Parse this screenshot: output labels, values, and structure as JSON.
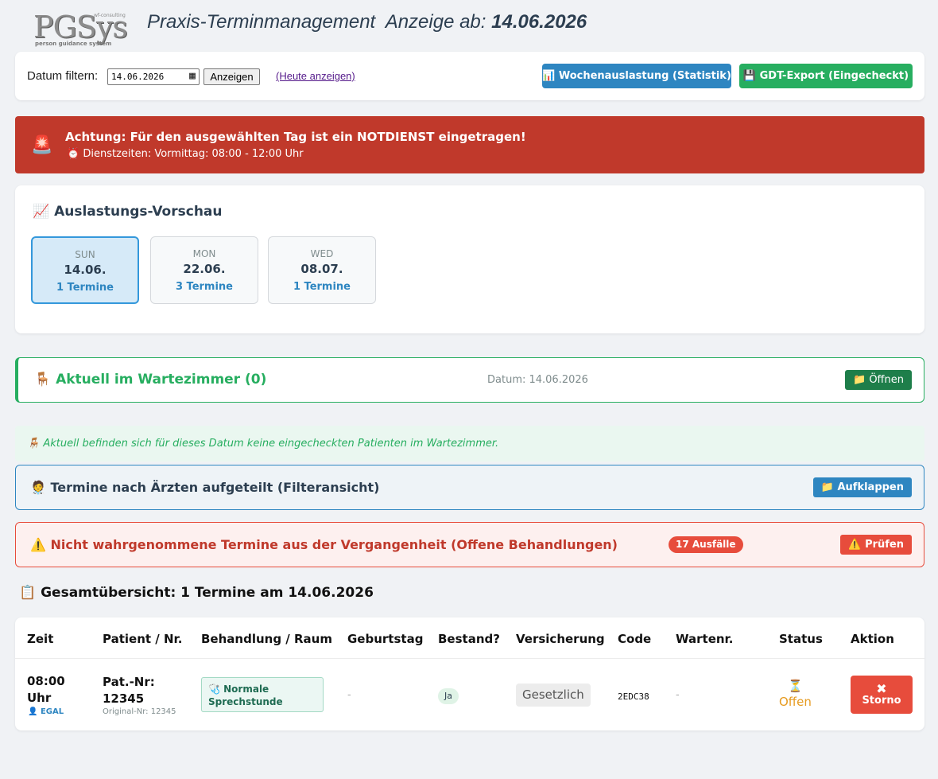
{
  "logo": {
    "text": "PGSys",
    "subtitle": "person guidance system",
    "topline": "wf-consulting"
  },
  "header": {
    "title": "Praxis-Terminmanagement",
    "date_prefix": "Anzeige ab:",
    "date": "14.06.2026"
  },
  "filter": {
    "label": "Datum filtern:",
    "date_value": "14.06.2026",
    "show_button": "Anzeigen",
    "today_link": "(Heute anzeigen)",
    "week_button": "Wochenauslastung (Statistik)",
    "gdt_button": "GDT-Export (Eingecheckt)"
  },
  "alert": {
    "title": "Achtung: Für den ausgewählten Tag ist ein NOTDIENST eingetragen!",
    "subtitle": "Dienstzeiten: Vormittag: 08:00 - 12:00 Uhr"
  },
  "preview": {
    "title": "Auslastungs-Vorschau",
    "days": [
      {
        "dow": "SUN",
        "date": "14.06.",
        "count": "1 Termine",
        "active": true
      },
      {
        "dow": "MON",
        "date": "22.06.",
        "count": "3 Termine",
        "active": false
      },
      {
        "dow": "WED",
        "date": "08.07.",
        "count": "1 Termine",
        "active": false
      }
    ]
  },
  "waiting": {
    "title": "Aktuell im Wartezimmer (0)",
    "date": "Datum: 14.06.2026",
    "open_button": "Öffnen",
    "empty_message": "Aktuell befinden sich für dieses Datum keine eingecheckten Patienten im Wartezimmer."
  },
  "doctors": {
    "title": "Termine nach Ärzten aufgeteilt (Filteransicht)",
    "button": "Aufklappen"
  },
  "missed": {
    "title": "Nicht wahrgenommene Termine aus der Vergangenheit (Offene Behandlungen)",
    "badge": "17 Ausfälle",
    "button": "Prüfen"
  },
  "overview": {
    "title": "Gesamtübersicht: 1 Termine am 14.06.2026",
    "columns": [
      "Zeit",
      "Patient / Nr.",
      "Behandlung / Raum",
      "Geburtstag",
      "Bestand?",
      "Versicherung",
      "Code",
      "Wartenr.",
      "Status",
      "Aktion"
    ],
    "rows": [
      {
        "time_line1": "08:00",
        "time_line2": "Uhr",
        "doctor": "EGAL",
        "patient_line1": "Pat.-Nr:",
        "patient_line2": "12345",
        "original": "Original-Nr: 12345",
        "treatment": "Normale Sprechstunde",
        "birthday": "-",
        "existing": "Ja",
        "insurance": "Gesetzlich",
        "code": "2EDC38",
        "wait_nr": "-",
        "status": "Offen",
        "action": "Storno"
      }
    ]
  }
}
